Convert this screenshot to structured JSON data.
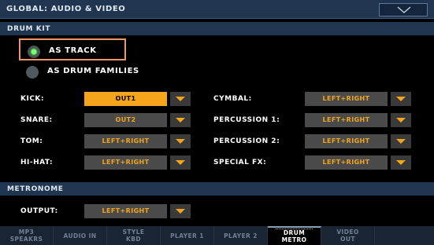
{
  "header": {
    "title": "GLOBAL: AUDIO & VIDEO",
    "menu_icon": "chevron-down-icon"
  },
  "drum_kit": {
    "section_label": "DRUM KIT",
    "mode_options": [
      {
        "label": "AS TRACK",
        "selected": true
      },
      {
        "label": "AS DRUM FAMILIES",
        "selected": false
      }
    ],
    "params_left": [
      {
        "label": "KICK:",
        "value": "OUT1"
      },
      {
        "label": "SNARE:",
        "value": "OUT2"
      },
      {
        "label": "TOM:",
        "value": "LEFT+RIGHT"
      },
      {
        "label": "HI-HAT:",
        "value": "LEFT+RIGHT"
      }
    ],
    "params_right": [
      {
        "label": "CYMBAL:",
        "value": "LEFT+RIGHT"
      },
      {
        "label": "PERCUSSION 1:",
        "value": "LEFT+RIGHT"
      },
      {
        "label": "PERCUSSION 2:",
        "value": "LEFT+RIGHT"
      },
      {
        "label": "SPECIAL FX:",
        "value": "LEFT+RIGHT"
      }
    ]
  },
  "metronome": {
    "section_label": "METRONOME",
    "output_label": "OUTPUT:",
    "output_value": "LEFT+RIGHT"
  },
  "tabs": [
    {
      "line1": "MP3",
      "line2": "SPEAKRS",
      "active": false
    },
    {
      "line1": "AUDIO IN",
      "line2": "",
      "active": false
    },
    {
      "line1": "STYLE",
      "line2": "KBD",
      "active": false
    },
    {
      "line1": "PLAYER 1",
      "line2": "",
      "active": false
    },
    {
      "line1": "PLAYER 2",
      "line2": "",
      "active": false
    },
    {
      "line1": "DRUM",
      "line2": "METRO",
      "active": true
    },
    {
      "line1": "VIDEO",
      "line2": "OUT",
      "active": false
    },
    {
      "line1": "",
      "line2": "",
      "active": false
    }
  ],
  "colors": {
    "accent": "#f5a51b",
    "header_bg": "#1f3550",
    "focus_frame": "#f0956a",
    "radio_on": "#7bff7b"
  }
}
